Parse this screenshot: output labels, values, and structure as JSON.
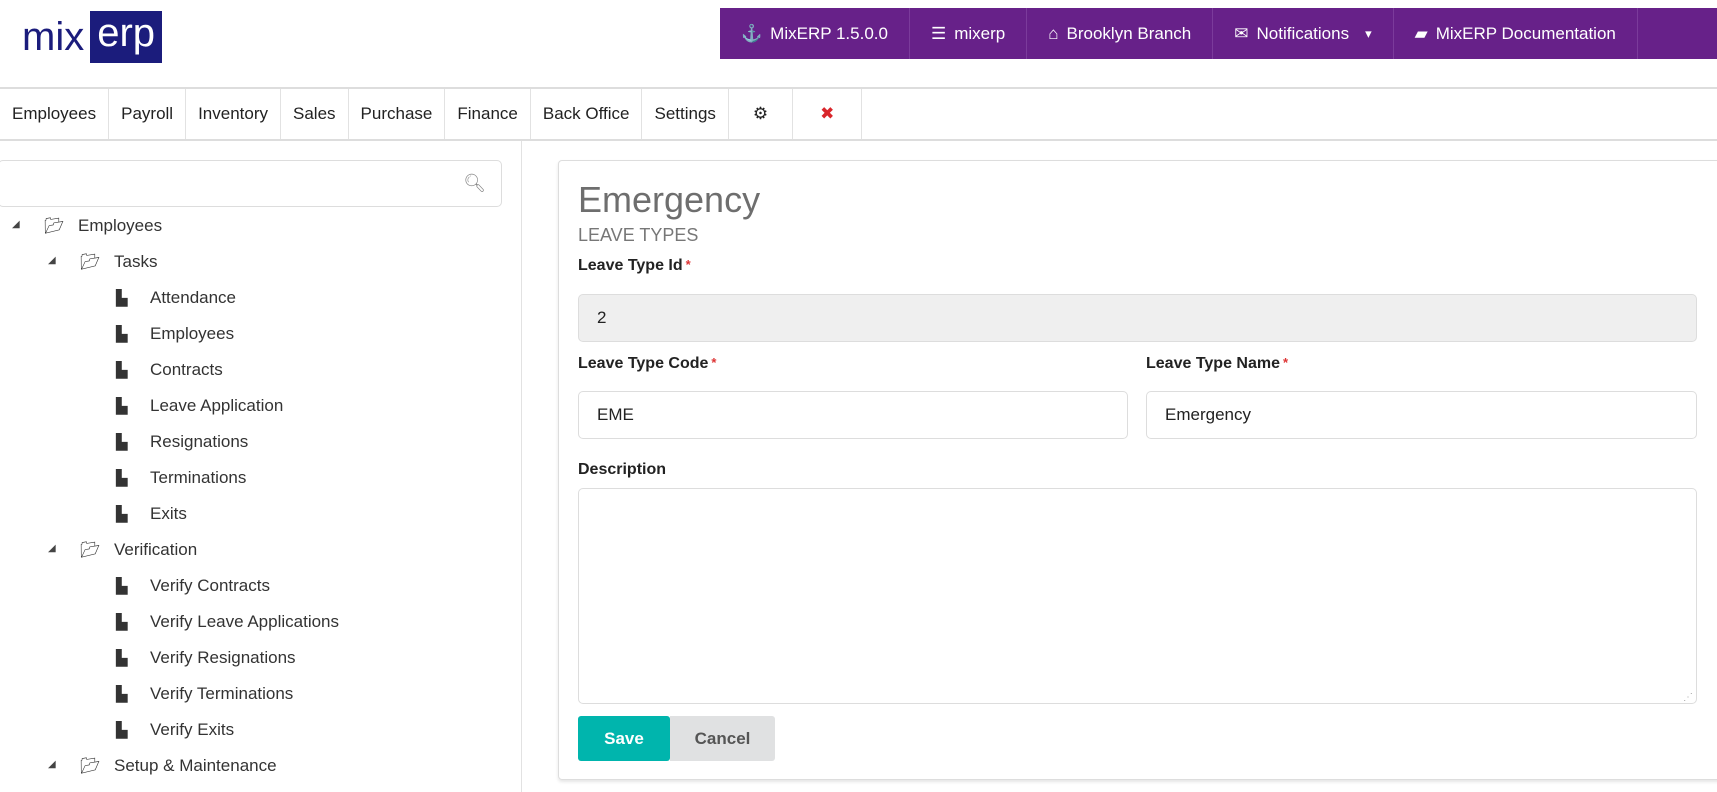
{
  "logo": {
    "part1": "mix",
    "part2": "erp"
  },
  "topbar": [
    {
      "icon": "anchor-icon",
      "glyph": "⚓",
      "label": "MixERP 1.5.0.0"
    },
    {
      "icon": "database-icon",
      "glyph": "☰",
      "label": "mixerp"
    },
    {
      "icon": "home-icon",
      "glyph": "⌂",
      "label": "Brooklyn Branch"
    },
    {
      "icon": "envelope-icon",
      "glyph": "✉",
      "label": "Notifications",
      "caret": "▾"
    },
    {
      "icon": "book-icon",
      "glyph": "▰",
      "label": "MixERP Documentation"
    }
  ],
  "nav": {
    "items": [
      "Employees",
      "Payroll",
      "Inventory",
      "Sales",
      "Purchase",
      "Finance",
      "Back Office",
      "Settings"
    ],
    "settings_glyph": "⚙",
    "close_glyph": "✖",
    "close_color": "#d9262b"
  },
  "sidebar": {
    "search_placeholder": "",
    "tree": [
      {
        "label": "Employees",
        "level": 0,
        "type": "folder"
      },
      {
        "label": "Tasks",
        "level": 1,
        "type": "folder"
      },
      {
        "label": "Attendance",
        "level": 2,
        "type": "file"
      },
      {
        "label": "Employees",
        "level": 2,
        "type": "file"
      },
      {
        "label": "Contracts",
        "level": 2,
        "type": "file"
      },
      {
        "label": "Leave Application",
        "level": 2,
        "type": "file"
      },
      {
        "label": "Resignations",
        "level": 2,
        "type": "file"
      },
      {
        "label": "Terminations",
        "level": 2,
        "type": "file"
      },
      {
        "label": "Exits",
        "level": 2,
        "type": "file"
      },
      {
        "label": "Verification",
        "level": 1,
        "type": "folder"
      },
      {
        "label": "Verify Contracts",
        "level": 2,
        "type": "file"
      },
      {
        "label": "Verify Leave Applications",
        "level": 2,
        "type": "file"
      },
      {
        "label": "Verify Resignations",
        "level": 2,
        "type": "file"
      },
      {
        "label": "Verify Terminations",
        "level": 2,
        "type": "file"
      },
      {
        "label": "Verify Exits",
        "level": 2,
        "type": "file"
      },
      {
        "label": "Setup & Maintenance",
        "level": 1,
        "type": "folder"
      }
    ]
  },
  "form": {
    "title": "Emergency",
    "subtitle": "LEAVE TYPES",
    "id_label": "Leave Type Id",
    "id_value": "2",
    "code_label": "Leave Type Code",
    "code_value": "EME",
    "name_label": "Leave Type Name",
    "name_value": "Emergency",
    "desc_label": "Description",
    "desc_value": "",
    "required_mark": "*",
    "save": "Save",
    "cancel": "Cancel",
    "save_color": "#00b5ad"
  }
}
